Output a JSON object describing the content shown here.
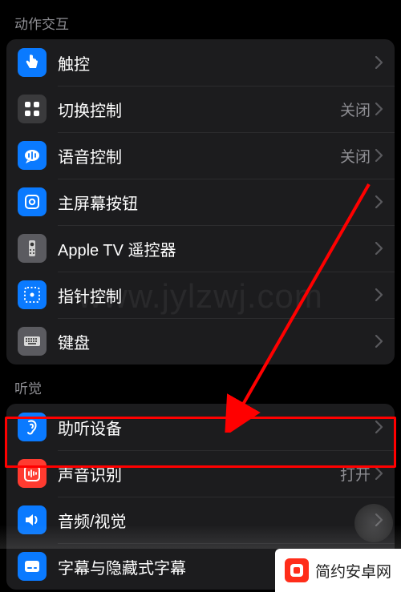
{
  "sections": [
    {
      "header": "动作交互",
      "items": [
        {
          "id": "touch",
          "label": "触控",
          "value": "",
          "icon": "touch-icon",
          "bg": "bg-blue"
        },
        {
          "id": "switch-control",
          "label": "切换控制",
          "value": "关闭",
          "icon": "grid-icon",
          "bg": "bg-darkgray"
        },
        {
          "id": "voice-control",
          "label": "语音控制",
          "value": "关闭",
          "icon": "voice-icon",
          "bg": "bg-blue"
        },
        {
          "id": "home-button",
          "label": "主屏幕按钮",
          "value": "",
          "icon": "home-button-icon",
          "bg": "bg-blue"
        },
        {
          "id": "apple-tv-remote",
          "label": "Apple TV 遥控器",
          "value": "",
          "icon": "remote-icon",
          "bg": "bg-gray"
        },
        {
          "id": "pointer-control",
          "label": "指针控制",
          "value": "",
          "icon": "pointer-icon",
          "bg": "bg-blue"
        },
        {
          "id": "keyboard",
          "label": "键盘",
          "value": "",
          "icon": "keyboard-icon",
          "bg": "bg-gray"
        }
      ]
    },
    {
      "header": "听觉",
      "items": [
        {
          "id": "hearing-devices",
          "label": "助听设备",
          "value": "",
          "icon": "ear-icon",
          "bg": "bg-blue"
        },
        {
          "id": "sound-recognition",
          "label": "声音识别",
          "value": "打开",
          "icon": "sound-recognition-icon",
          "bg": "bg-red"
        },
        {
          "id": "audio-visual",
          "label": "音频/视觉",
          "value": "",
          "icon": "audio-icon",
          "bg": "bg-blue"
        },
        {
          "id": "subtitles",
          "label": "字幕与隐藏式字幕",
          "value": "",
          "icon": "subtitles-icon",
          "bg": "bg-blue"
        }
      ]
    }
  ],
  "watermark": "www.jylzwj.com",
  "footer": {
    "text": "简约安卓网"
  },
  "annotations": {
    "highlight_target": "sound-recognition",
    "arrow_color": "#ff0000"
  }
}
